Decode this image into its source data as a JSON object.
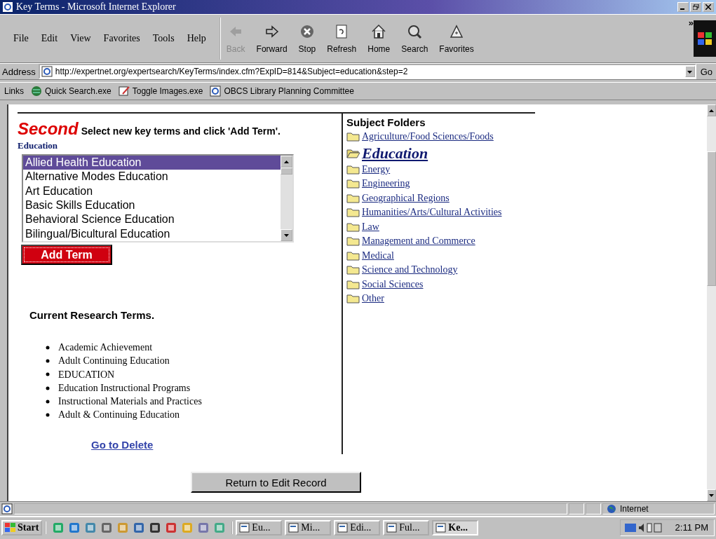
{
  "window": {
    "title": "Key Terms - Microsoft Internet Explorer"
  },
  "menu": [
    "File",
    "Edit",
    "View",
    "Favorites",
    "Tools",
    "Help"
  ],
  "toolbar": [
    {
      "kind": "back",
      "label": "Back",
      "disabled": true
    },
    {
      "kind": "forward",
      "label": "Forward",
      "disabled": false
    },
    {
      "kind": "stop",
      "label": "Stop",
      "disabled": false
    },
    {
      "kind": "refresh",
      "label": "Refresh",
      "disabled": false
    },
    {
      "kind": "home",
      "label": "Home",
      "disabled": false
    },
    {
      "kind": "search",
      "label": "Search",
      "disabled": false
    },
    {
      "kind": "favorites",
      "label": "Favorites",
      "disabled": false
    }
  ],
  "chevron": "»",
  "address": {
    "label": "Address",
    "url": "http://expertnet.org/expertsearch/KeyTerms/index.cfm?ExpID=814&Subject=education&step=2",
    "go": "Go"
  },
  "links": {
    "label": "Links",
    "items": [
      {
        "kind": "globe",
        "label": "Quick Search.exe"
      },
      {
        "kind": "edit",
        "label": "Toggle Images.exe"
      },
      {
        "kind": "ie",
        "label": "OBCS Library Planning Committee"
      }
    ]
  },
  "page": {
    "step": "Second",
    "instruction": "Select new key terms and click 'Add Term'.",
    "list_label": "Education",
    "terms_list": [
      {
        "label": "Allied Health Education",
        "selected": true
      },
      {
        "label": "Alternative Modes Education",
        "selected": false
      },
      {
        "label": "Art Education",
        "selected": false
      },
      {
        "label": "Basic Skills Education",
        "selected": false
      },
      {
        "label": "Behavioral Science Education",
        "selected": false
      },
      {
        "label": "Bilingual/Bicultural Education",
        "selected": false
      }
    ],
    "add_button": "Add Term",
    "current_heading": "Current Research Terms.",
    "current_terms": [
      "Academic Achievement",
      "Adult Continuing Education",
      "EDUCATION",
      "Education Instructional Programs",
      "Instructional Materials and Practices",
      "Adult & Continuing Education"
    ],
    "delete_link": "Go to Delete",
    "folders_heading": "Subject Folders",
    "folders": [
      {
        "label": "Agriculture/Food Sciences/Foods",
        "expanded": false
      },
      {
        "label": "Education",
        "expanded": true
      },
      {
        "label": "Energy",
        "expanded": false
      },
      {
        "label": "Engineering",
        "expanded": false
      },
      {
        "label": "Geographical Regions",
        "expanded": false
      },
      {
        "label": "Humanities/Arts/Cultural Activities",
        "expanded": false
      },
      {
        "label": "Law",
        "expanded": false
      },
      {
        "label": "Management and Commerce",
        "expanded": false
      },
      {
        "label": "Medical",
        "expanded": false
      },
      {
        "label": "Science and Technology",
        "expanded": false
      },
      {
        "label": "Social Sciences",
        "expanded": false
      },
      {
        "label": "Other",
        "expanded": false
      }
    ],
    "return_button": "Return to Edit Record"
  },
  "status_bar": {
    "zone": "Internet"
  },
  "taskbar": {
    "start": "Start",
    "tasks": [
      {
        "label": "Eu...",
        "active": false
      },
      {
        "label": "Mi...",
        "active": false
      },
      {
        "label": "Edi...",
        "active": false
      },
      {
        "label": "Ful...",
        "active": false
      },
      {
        "label": "Ke...",
        "active": true
      }
    ],
    "clock": "2:11 PM"
  }
}
